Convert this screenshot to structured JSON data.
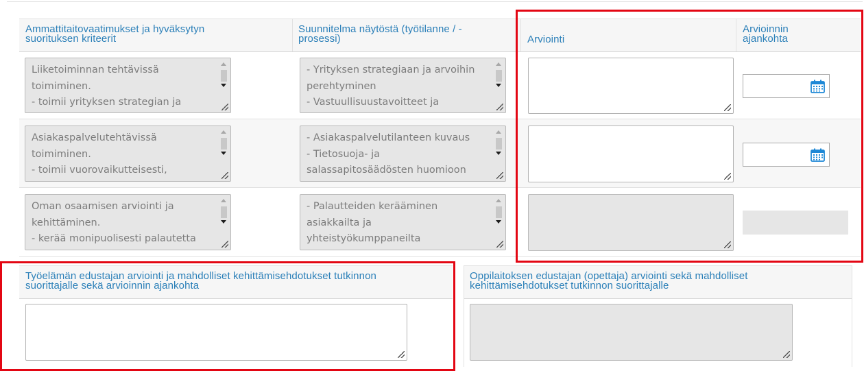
{
  "table": {
    "headers": {
      "criteria": "Ammattitaitovaatimukset ja hyväksytyn\nsuorituksen kriteerit",
      "plan": "Suunnitelma näytöstä (työtilanne / -\nprosessi)",
      "assessment": "Arviointi",
      "assessment_time": "Arvioinnin\najankohta"
    },
    "rows": [
      {
        "criteria": "Liiketoiminnan tehtävissä\ntoimiminen.\n- toimii yrityksen strategian ja",
        "plan": "- Yrityksen strategiaan ja arvoihin\nperehtyminen\n- Vastuullisuustavoitteet ja",
        "assessment": "",
        "date": ""
      },
      {
        "criteria": "Asiakaspalvelutehtävissä\ntoimiminen.\n- toimii vuorovaikutteisesti,",
        "plan": "- Asiakaspalvelutilanteen kuvaus\n- Tietosuoja- ja\nsalassapitosäädösten huomioon",
        "assessment": "",
        "date": ""
      },
      {
        "criteria": "Oman osaamisen arviointi ja\nkehittäminen.\n- kerää monipuolisesti palautetta",
        "plan": "- Palautteiden kerääminen\nasiakkailta ja\nyhteistyökumppaneilta",
        "assessment": "",
        "date": ""
      }
    ]
  },
  "bottom": {
    "employer_header": "Työelämän edustajan arviointi ja mahdolliset kehittämisehdotukset tutkinnon\nsuorittajalle sekä arvioinnin ajankohta",
    "employer_value": "",
    "teacher_header": "Oppilaitoksen edustajan (opettaja) arviointi sekä mahdolliset\nkehittämisehdotukset tutkinnon suorittajalle",
    "teacher_value": ""
  },
  "icons": {
    "calendar": "calendar-icon"
  },
  "colors": {
    "header_text": "#2a7fb8",
    "highlight": "#e30613",
    "calendar": "#1e88d6"
  }
}
